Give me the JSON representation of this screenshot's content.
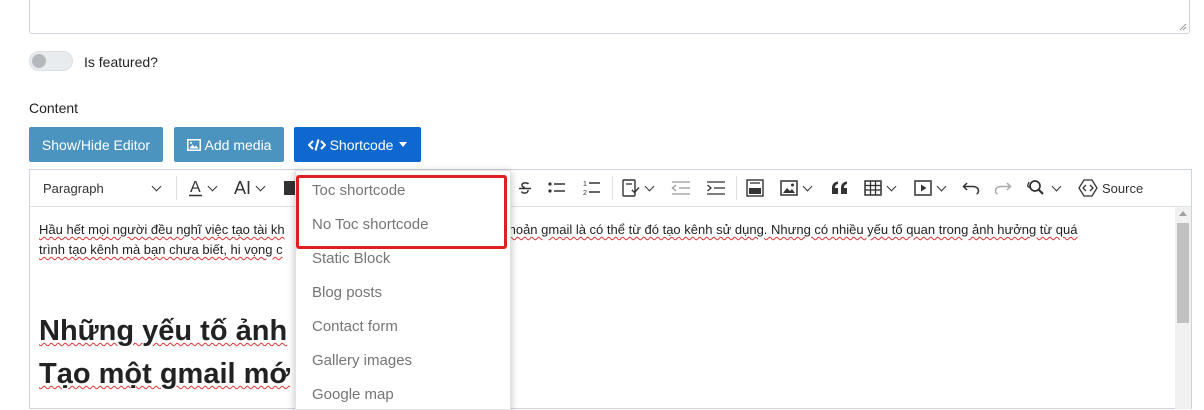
{
  "featured": {
    "label": "Is featured?",
    "enabled": false
  },
  "content": {
    "label": "Content"
  },
  "buttons": {
    "show_hide": "Show/Hide Editor",
    "add_media": "Add media",
    "shortcode": "Shortcode"
  },
  "colors": {
    "secondary_button": "#4b94c0",
    "primary_button": "#0f68cf",
    "highlight_border": "#e02020"
  },
  "toolbar": {
    "paragraph": "Paragraph",
    "font_size": "AI",
    "source": "Source",
    "icons": [
      "font-color-icon",
      "font-size-icon",
      "highlight-icon",
      "strikethrough-icon",
      "bulleted-list-icon",
      "numbered-list-icon",
      "todo-list-icon",
      "outdent-icon",
      "indent-icon",
      "html-embed-icon",
      "image-icon",
      "blockquote-icon",
      "table-icon",
      "media-icon",
      "undo-icon",
      "redo-icon",
      "find-replace-icon",
      "source-icon"
    ]
  },
  "editor": {
    "paragraph_start": "Hầu hết mọi người đều nghĩ việc tạo tài kh",
    "paragraph_end": "a tại tài khoản gmail là có thể từ đó tạo kênh sử dụng. Nhưng có nhiều yếu tố quan trong ảnh hưởng từ quá",
    "paragraph_line2": "trình tạo kênh mà bạn chưa biết, hi vọng c",
    "heading_line1": "Những yếu tố ảnh",
    "heading_line2": "Tạo một gmail mớ"
  },
  "dropdown": {
    "items": [
      "Toc shortcode",
      "No Toc shortcode",
      "Static Block",
      "Blog posts",
      "Contact form",
      "Gallery images",
      "Google map"
    ]
  }
}
